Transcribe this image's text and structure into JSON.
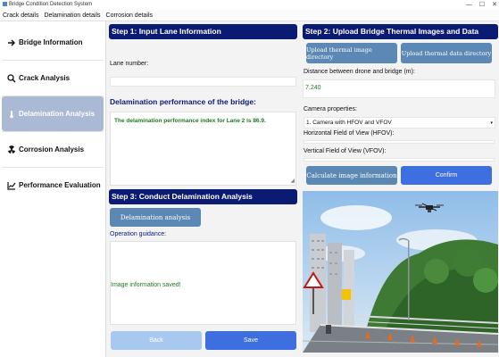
{
  "window": {
    "title": "Bridge Condition Detection System"
  },
  "menu": [
    "Crack details",
    "Delamination details",
    "Corrosion details"
  ],
  "sidebar": {
    "items": [
      {
        "label": "Bridge Information",
        "icon": "arrow-right-icon"
      },
      {
        "label": "Crack Analysis",
        "icon": "search-icon"
      },
      {
        "label": "Delamination Analysis",
        "icon": "thermometer-icon"
      },
      {
        "label": "Corrosion Analysis",
        "icon": "radiation-icon"
      },
      {
        "label": "Performance Evaluation",
        "icon": "line-chart-icon"
      }
    ],
    "active": "Delamination Analysis"
  },
  "step1": {
    "header": "Step 1: Input Lane Information",
    "lane_label": "Lane number:",
    "lane_value": "",
    "perf_label": "Delamination performance of the bridge:",
    "perf_text": "The delamination performance index for Lane 2 is 86.9."
  },
  "step3": {
    "header": "Step 3: Conduct Delamination Analysis",
    "analysis_button": "Delamination analysis",
    "guidance_label": "Operation guidance:",
    "guidance_text": "Image information saved!",
    "back_button": "Back",
    "save_button": "Save"
  },
  "step2": {
    "header": "Step 2: Upload Bridge Thermal Images and Data",
    "upload_images_button": "Upload thermal image directory",
    "upload_data_button": "Upload thermal data directory",
    "distance_label": "Distance between drone and bridge (m):",
    "distance_value": "7.240",
    "camera_label": "Camera properties:",
    "camera_selected": "1. Camera with HFOV and VFOV",
    "hfov_label": "Horizontal Field of View (HFOV):",
    "hfov_value": "",
    "vfov_label": "Vertical Field of View (VFOV):",
    "vfov_value": "",
    "calculate_button": "Calculate image information",
    "confirm_button": "Confirm"
  },
  "colors": {
    "header_bg": "#0b1b73",
    "active_nav": "#aab9d4",
    "perf_text": "#1e7a1e",
    "guidance_text": "#1e7a1e",
    "step_label_blue": "#0b1b73",
    "distance_value": "#1e7a1e",
    "primary_button": "#3d6fe0",
    "steel_button": "#5b88b5"
  }
}
